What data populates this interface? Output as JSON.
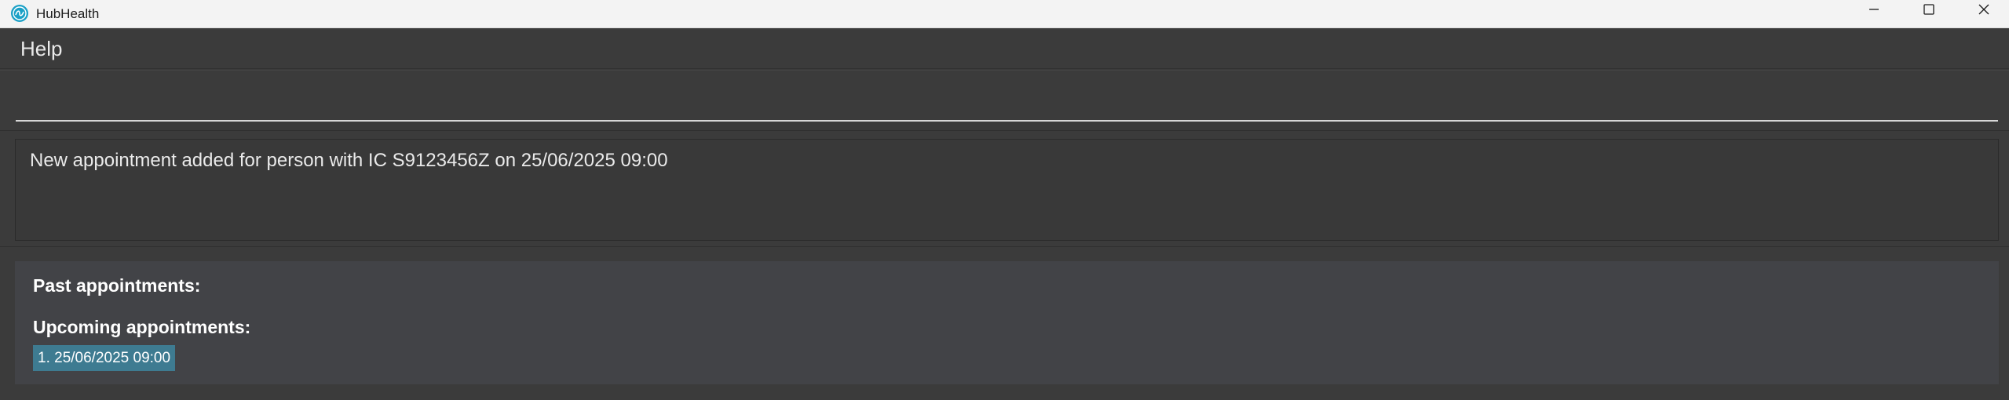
{
  "window": {
    "title": "HubHealth",
    "icon": "hubhealth-logo-icon",
    "controls": [
      "minimize-icon",
      "maximize-icon",
      "close-icon"
    ]
  },
  "menu": {
    "items": [
      {
        "label": "Help"
      }
    ]
  },
  "command": {
    "value": "",
    "placeholder": ""
  },
  "result": {
    "message": "New appointment added for person with IC S9123456Z on 25/06/2025 09:00"
  },
  "appointments": {
    "past_label": "Past appointments:",
    "upcoming_label": "Upcoming appointments:",
    "upcoming": [
      {
        "text": "1. 25/06/2025 09:00"
      }
    ]
  },
  "colors": {
    "background": "#3b3b3b",
    "panel": "#424347",
    "chip": "#3e7b91",
    "logo": "#1aa0c6"
  }
}
